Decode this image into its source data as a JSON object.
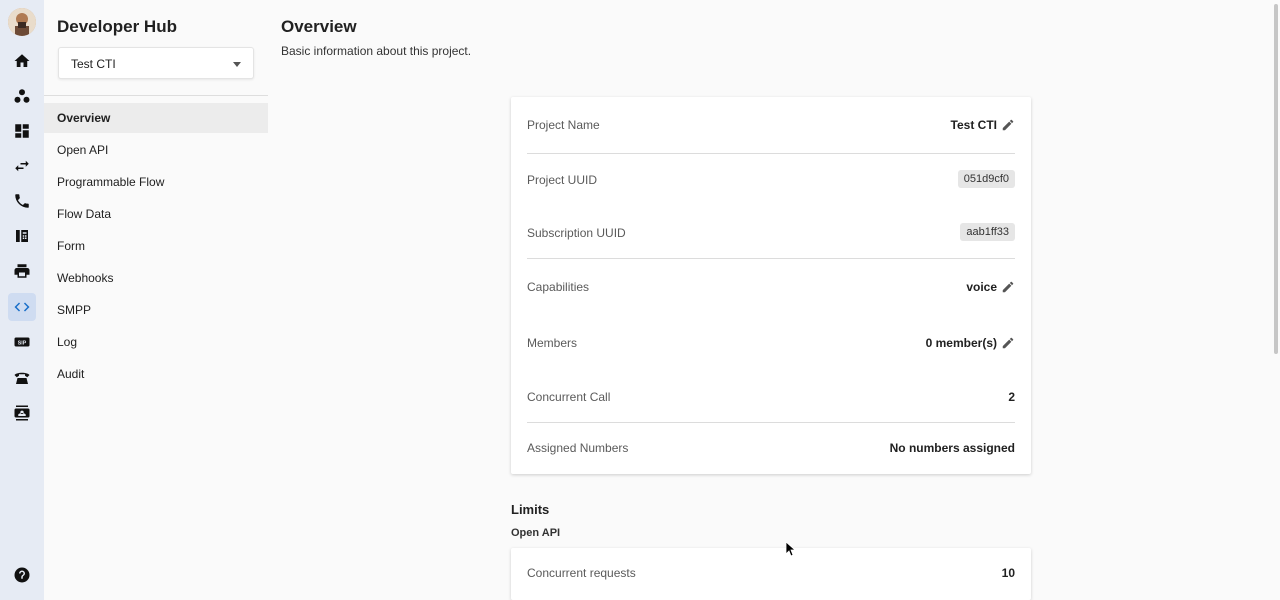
{
  "rail": {
    "icons": [
      "home-icon",
      "groups-icon",
      "dashboard-icon",
      "swap-icon",
      "phone-icon",
      "fax-icon",
      "print-icon",
      "code-icon",
      "sip-icon",
      "telephone-icon",
      "contacts-icon",
      "help-icon"
    ],
    "sip_label": "SIP",
    "active": "code-icon",
    "accent": "#1a6fc9"
  },
  "sidebar": {
    "title": "Developer Hub",
    "project_select": "Test CTI",
    "items": [
      {
        "label": "Overview",
        "active": true
      },
      {
        "label": "Open API"
      },
      {
        "label": "Programmable Flow"
      },
      {
        "label": "Flow Data"
      },
      {
        "label": "Form"
      },
      {
        "label": "Webhooks"
      },
      {
        "label": "SMPP"
      },
      {
        "label": "Log"
      },
      {
        "label": "Audit"
      }
    ]
  },
  "main": {
    "title": "Overview",
    "subtitle": "Basic information about this project.",
    "details": {
      "project_name": {
        "label": "Project Name",
        "value": "Test CTI"
      },
      "project_uuid": {
        "label": "Project UUID",
        "value": "051d9cf0"
      },
      "subscription_uuid": {
        "label": "Subscription UUID",
        "value": "aab1ff33"
      },
      "capabilities": {
        "label": "Capabilities",
        "value": "voice"
      },
      "members": {
        "label": "Members",
        "value": "0 member(s)"
      },
      "concurrent_call": {
        "label": "Concurrent Call",
        "value": "2"
      },
      "assigned_numbers": {
        "label": "Assigned Numbers",
        "value": "No numbers assigned"
      }
    },
    "limits": {
      "title": "Limits",
      "section": "Open API",
      "concurrent_requests": {
        "label": "Concurrent requests",
        "value": "10"
      }
    }
  }
}
